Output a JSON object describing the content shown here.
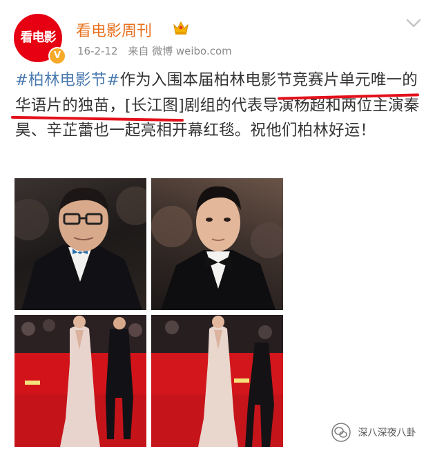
{
  "header": {
    "avatar_text": "看电影",
    "username": "看电影周刊",
    "date": "16-2-12",
    "source": "来自 微博 weibo.com",
    "verified_mark": "V",
    "brand_color": "#e60012",
    "username_color": "#e8711e"
  },
  "post": {
    "hashtag": "#柏林电影节#",
    "seg1": "作为入围本届柏林电",
    "seg2": "影节竞赛片单元",
    "seg3": "唯一的华语片的独苗",
    "seg4": "，[长江图]剧组的代表导演杨超和两位主演秦昊、辛芷蕾也一起亮相开幕红毯。祝他们柏林好运！",
    "hashtag_color": "#4a7aaf",
    "underline_color": "#e3101b"
  },
  "photos": [
    {
      "id": "photo-director",
      "icon": "portrait-man-glasses"
    },
    {
      "id": "photo-actor",
      "icon": "portrait-man-bowtie"
    },
    {
      "id": "photo-red-carpet-1",
      "icon": "red-carpet-gown"
    },
    {
      "id": "photo-red-carpet-2",
      "icon": "red-carpet-gown"
    }
  ],
  "watermark": {
    "text": "深八深夜八卦"
  }
}
